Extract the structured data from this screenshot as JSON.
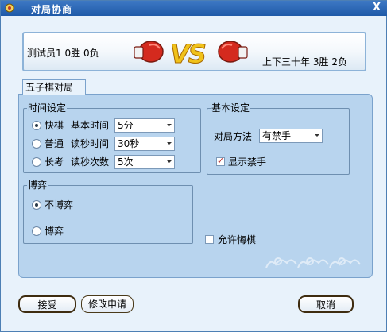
{
  "window": {
    "title": "对局协商",
    "close_symbol": "X"
  },
  "banner": {
    "player1": {
      "name": "测试员1",
      "wins": "0胜",
      "losses": "0负"
    },
    "vs_text": "VS",
    "player2": {
      "name": "上下三十年",
      "wins": "3胜",
      "losses": "2负"
    }
  },
  "tab": {
    "label": "五子棋对局"
  },
  "time_settings": {
    "title": "时间设定",
    "modes": [
      {
        "label": "快棋",
        "checked": true
      },
      {
        "label": "普通",
        "checked": false
      },
      {
        "label": "长考",
        "checked": false
      }
    ],
    "fields": [
      {
        "label": "基本时间",
        "value": "5分"
      },
      {
        "label": "读秒时间",
        "value": "30秒"
      },
      {
        "label": "读秒次数",
        "value": "5次"
      }
    ]
  },
  "basic_settings": {
    "title": "基本设定",
    "rule_label": "对局方法",
    "rule_value": "有禁手",
    "show_forbidden_label": "显示禁手",
    "show_forbidden_checked": true
  },
  "gamble": {
    "title": "博弈",
    "options": [
      {
        "label": "不博弈",
        "checked": true
      },
      {
        "label": "博弈",
        "checked": false
      }
    ]
  },
  "allow_undo": {
    "label": "允许悔棋",
    "checked": false
  },
  "buttons": {
    "accept": "接受",
    "modify": "修改申请",
    "cancel": "取消"
  },
  "colors": {
    "title_bar": "#1f5aa8",
    "panel": "#b8d4ee",
    "vs": "#f0c21a",
    "glove": "#d42a1e"
  }
}
